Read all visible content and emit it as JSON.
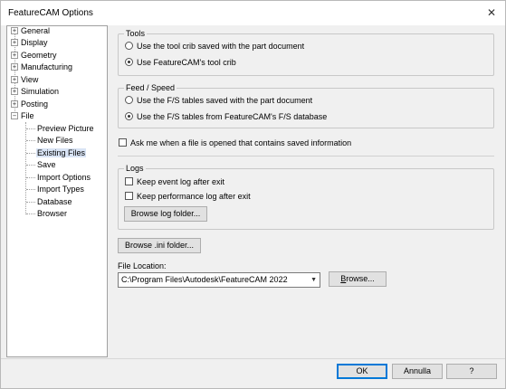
{
  "window": {
    "title": "FeatureCAM Options",
    "close_glyph": "✕"
  },
  "tree": {
    "top_items": [
      {
        "label": "General",
        "expander": "+"
      },
      {
        "label": "Display",
        "expander": "+"
      },
      {
        "label": "Geometry",
        "expander": "+"
      },
      {
        "label": "Manufacturing",
        "expander": "+"
      },
      {
        "label": "View",
        "expander": "+"
      },
      {
        "label": "Simulation",
        "expander": "+"
      },
      {
        "label": "Posting",
        "expander": "+"
      },
      {
        "label": "File",
        "expander": "−"
      }
    ],
    "file_children": [
      "Preview Picture",
      "New Files",
      "Existing Files",
      "Save",
      "Import Options",
      "Import Types",
      "Database",
      "Browser"
    ],
    "selected": "Existing Files"
  },
  "tools": {
    "title": "Tools",
    "option1": "Use the tool crib saved with the part document",
    "option2": "Use FeatureCAM's tool crib",
    "selected": 2
  },
  "feed_speed": {
    "title": "Feed / Speed",
    "option1": "Use the F/S tables saved with the part document",
    "option2": "Use the F/S tables from FeatureCAM's F/S database",
    "selected": 2
  },
  "ask_checkbox": {
    "label": "Ask me when a file is opened that contains saved information",
    "checked": false
  },
  "logs": {
    "title": "Logs",
    "event_log": "Keep event log after exit",
    "perf_log": "Keep performance log after exit",
    "browse_button": "Browse log folder..."
  },
  "browse_ini_button": "Browse .ini folder...",
  "file_location": {
    "label": "File Location:",
    "value": "C:\\Program Files\\Autodesk\\FeatureCAM 2022",
    "browse_prefix": "",
    "browse_underlined": "B",
    "browse_rest": "rowse..."
  },
  "footer": {
    "ok": "OK",
    "cancel": "Annulla",
    "help": "?"
  },
  "colors": {
    "selection": "#d9e4f5",
    "default_button_border": "#0078d7"
  }
}
